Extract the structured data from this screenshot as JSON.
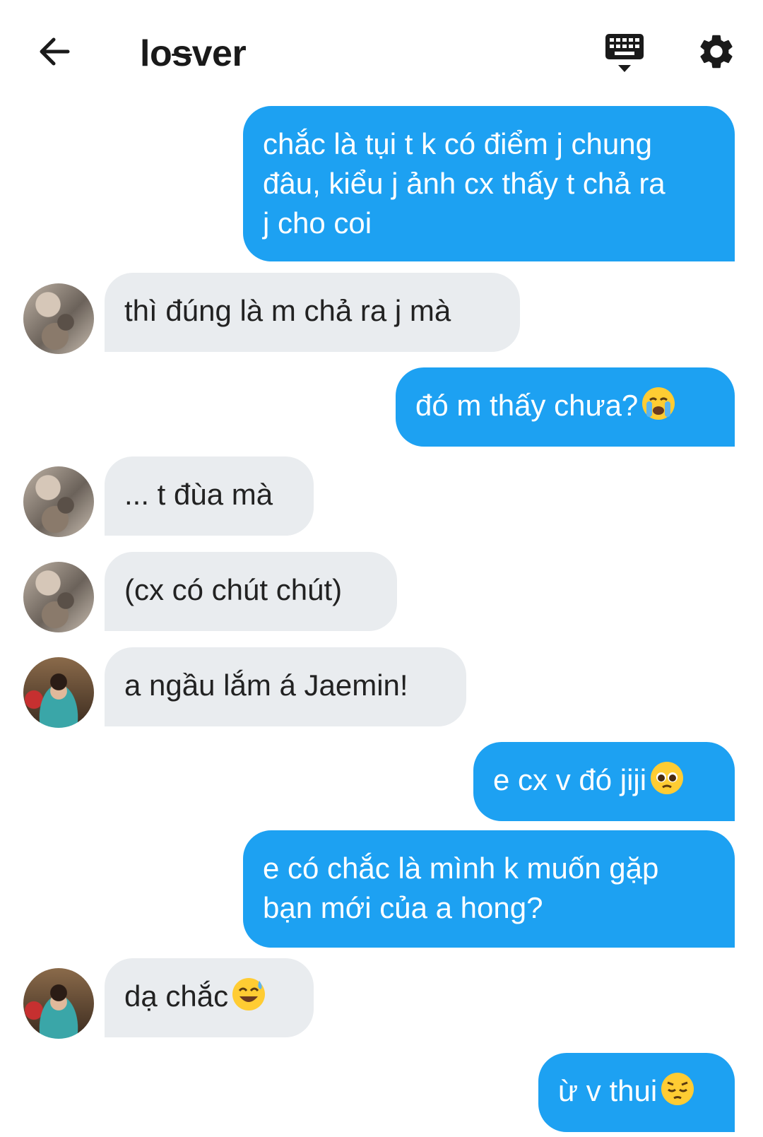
{
  "header": {
    "title_part1": "lo",
    "title_strike": "s",
    "title_part2": "ver"
  },
  "icons": {
    "back": "arrow-left-icon",
    "keyboard": "keyboard-icon",
    "settings": "gear-icon"
  },
  "messages": [
    {
      "side": "out",
      "text": "chắc là tụi t k có điểm j chung\nđâu, kiểu j ảnh cx thấy t chả ra\nj cho coi"
    },
    {
      "side": "in",
      "avatar": "avatar-1",
      "text": "thì đúng là m chả ra j mà"
    },
    {
      "side": "out",
      "text": "đó m thấy chưa?",
      "emoji": "loudly-crying-face"
    },
    {
      "side": "in",
      "avatar": "avatar-1",
      "text": "... t đùa mà"
    },
    {
      "side": "in",
      "avatar": "avatar-1",
      "text": "(cx có chút chút)"
    },
    {
      "side": "in",
      "avatar": "avatar-2",
      "text": "a ngầu lắm á Jaemin!"
    },
    {
      "side": "out",
      "text": "e cx v đó jiji",
      "emoji": "pleading-face"
    },
    {
      "side": "out",
      "text": "e có chắc là mình k muốn gặp\nbạn mới của a hong?"
    },
    {
      "side": "in",
      "avatar": "avatar-2",
      "text": "dạ chắc",
      "emoji": "grinning-sweat-face"
    },
    {
      "side": "out",
      "text": "ừ v thui",
      "emoji": "pensive-face"
    }
  ],
  "colors": {
    "outgoing_bubble": "#1da1f2",
    "incoming_bubble": "#e9ecef"
  }
}
